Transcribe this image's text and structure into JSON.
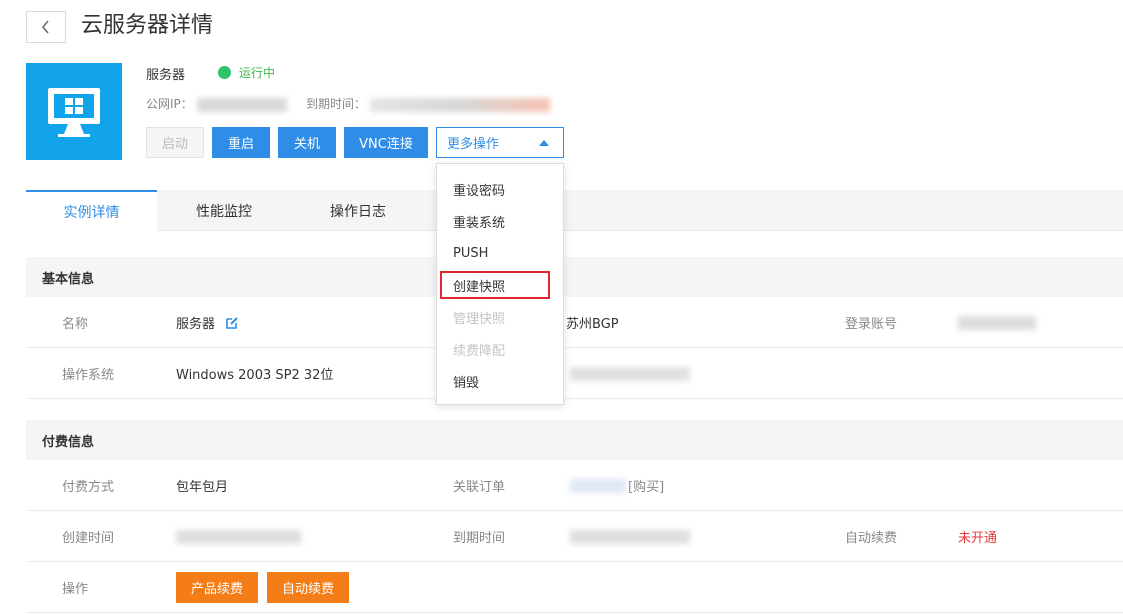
{
  "header": {
    "title": "云服务器详情",
    "back_icon": "chevron-left-icon"
  },
  "server": {
    "name": "服务器",
    "status": "运行中",
    "public_ip_label": "公网IP：",
    "expire_label": "到期时间：",
    "status_color": "#2fc26a"
  },
  "actions": {
    "start": "启动",
    "restart": "重启",
    "shutdown": "关机",
    "vnc": "VNC连接",
    "more": "更多操作"
  },
  "dropdown": {
    "items": [
      {
        "label": "重设密码",
        "enabled": true
      },
      {
        "label": "重装系统",
        "enabled": true
      },
      {
        "label": "PUSH",
        "enabled": true
      },
      {
        "label": "创建快照",
        "enabled": true,
        "highlighted": true
      },
      {
        "label": "管理快照",
        "enabled": false
      },
      {
        "label": "续费降配",
        "enabled": false
      },
      {
        "label": "销毁",
        "enabled": true
      }
    ]
  },
  "tabs": [
    {
      "label": "实例详情",
      "active": true
    },
    {
      "label": "性能监控",
      "active": false
    },
    {
      "label": "操作日志",
      "active": false
    }
  ],
  "basic": {
    "title": "基本信息",
    "name_label": "名称",
    "name_value": "服务器",
    "region_value": "苏州BGP",
    "login_label": "登录账号",
    "os_label": "操作系统",
    "os_value": "Windows 2003 SP2 32位"
  },
  "billing": {
    "title": "付费信息",
    "pay_label": "付费方式",
    "pay_value": "包年包月",
    "order_label": "关联订单",
    "order_link": "[购买]",
    "created_label": "创建时间",
    "expire_label": "到期时间",
    "auto_renew_label": "自动续费",
    "auto_renew_value": "未开通",
    "ops_label": "操作",
    "renew_btn": "产品续费",
    "auto_renew_btn": "自动续费"
  },
  "colors": {
    "accent": "#2f8de8",
    "orange": "#f57d18",
    "danger": "#e4393c"
  }
}
